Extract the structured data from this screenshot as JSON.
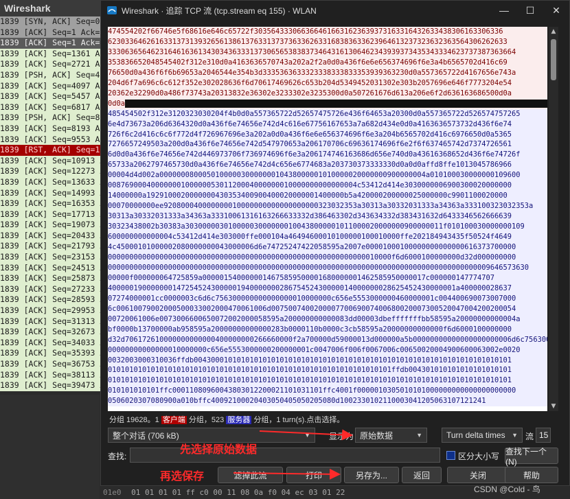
{
  "background": {
    "partial_title": "Wireshark",
    "rows": [
      {
        "text": "1839 [SYN, ACK] Seq=0",
        "style": "gray"
      },
      {
        "text": "1839 [ACK] Seq=1 Ack=3",
        "style": "gray"
      },
      {
        "text": "1839 [ACK] Seq=1 Ack=3",
        "style": "dark"
      },
      {
        "text": "1839 [ACK] Seq=1361 Ac",
        "style": "green"
      },
      {
        "text": "1839 [ACK] Seq=2721 Ac",
        "style": "green"
      },
      {
        "text": "1839 [PSH, ACK] Seq=40",
        "style": "green"
      },
      {
        "text": "1839 [ACK] Seq=4097 Ac",
        "style": "green"
      },
      {
        "text": "1839 [ACK] Seq=5457 Ac",
        "style": "green"
      },
      {
        "text": "1839 [ACK] Seq=6817 Ac",
        "style": "green"
      },
      {
        "text": "1839 [PSH, ACK] Seq=81",
        "style": "green"
      },
      {
        "text": "1839 [ACK] Seq=8193 Ac",
        "style": "green"
      },
      {
        "text": "1839 [ACK] Seq=9553 Ac",
        "style": "green"
      },
      {
        "text": "1839 [RST, ACK] Seq=1",
        "style": "red"
      },
      {
        "text": "1839 [ACK] Seq=10913 A",
        "style": "green"
      },
      {
        "text": "1839 [ACK] Seq=12273 A",
        "style": "green"
      },
      {
        "text": "1839 [ACK] Seq=13633 A",
        "style": "green"
      },
      {
        "text": "1839 [ACK] Seq=14993 A",
        "style": "green"
      },
      {
        "text": "1839 [ACK] Seq=16353 A",
        "style": "green"
      },
      {
        "text": "1839 [ACK] Seq=17713 A",
        "style": "green"
      },
      {
        "text": "1839 [ACK] Seq=19073 A",
        "style": "green"
      },
      {
        "text": "1839 [ACK] Seq=20433 A",
        "style": "green"
      },
      {
        "text": "1839 [ACK] Seq=21793 A",
        "style": "green"
      },
      {
        "text": "1839 [ACK] Seq=23153 A",
        "style": "green"
      },
      {
        "text": "1839 [ACK] Seq=24513 A",
        "style": "green"
      },
      {
        "text": "1839 [ACK] Seq=25873 A",
        "style": "green"
      },
      {
        "text": "1839 [ACK] Seq=27233 A",
        "style": "green"
      },
      {
        "text": "1839 [ACK] Seq=28593 A",
        "style": "green"
      },
      {
        "text": "1839 [ACK] Seq=29953 A",
        "style": "green"
      },
      {
        "text": "1839 [ACK] Seq=31313 A",
        "style": "green"
      },
      {
        "text": "1839 [ACK] Seq=32673 A",
        "style": "green"
      },
      {
        "text": "1839 [ACK] Seq=34033 A",
        "style": "green"
      },
      {
        "text": "1839 [ACK] Seq=35393 A",
        "style": "green"
      },
      {
        "text": "1839 [ACK] Seq=36753 A",
        "style": "green"
      },
      {
        "text": "1839 [ACK] Seq=38113 A",
        "style": "green"
      },
      {
        "text": "1839 [ACK] Seq=39473 A",
        "style": "green"
      }
    ],
    "hex_offset": "01e0",
    "hex_bytes": "01 01 01 01 ff c0 00 11  08 0a f0 04 ec 03 01 22"
  },
  "dialog": {
    "title": "Wireshark · 追踪 TCP 流 (tcp.stream eq 155) · WLAN",
    "window_controls": {
      "minimize": "—",
      "maximize": "☐",
      "close": "✕"
    },
    "client_lines": [
      "474554202f66746e5f68616e646c65722f3035643330663664616631623639373163316432633438306163306336",
      "623033646261633137313932656138613763313737363362633168383633623964613237323632363564306262633",
      "33306365646231646163613430343633313730656538383734643161306462343939373435343334623737387363664",
      "353836652048545402f312e310d0a4163636570743a202a2f2a0d0a436f6e6e656374696f6e3a4b6565702d416c69",
      "76650d0a436f6f6b69653a2046544e354b3d3335363633323338333833353939363230d0a557365722d4167656e743a",
      "204d6f7a696c6c612f352e302028636f6d70617469626c653b204d5349452031302e303b2057696e646f7773204e54",
      "20362e32290d0a486f73743a20313832e36302e3233302e3235300d0a507261676d613a206e6f2d636163686500d0a",
      "0d0a"
    ],
    "server_lines": [
      "485454502f312e3120323030204f4b0d0a557365722d52657475726e436f64653a20300d0a557365722d526574757265",
      "6e4d73673a206d6364320d0a436f6e74656e742d4c616e67756167653a7a682d434e0d0a4163636573732d436f6e74",
      "726f6c2d416c6c6f772d4f726967696e3a202a0d0a436f6e6e656374696f6e3a204b6565702d416c6976650d0a5365",
      "7276657249503a200d0a436f6e74656e742d547970653a206170706c69636174696f6e2f6f637465742d7374726561",
      "6d0d0a436f6e74656e742d446973706f736974696f6e3a206174746163686d656e740d0a43616368652d436f6e74726f",
      "65733a2062797465730d0a436f6e74656e742d4c656e6774683a203730373333330d0a0d0affd8ffe1013045786966",
      "00004d4d002a00000008000501000003000000010438000001010000020000000900000004a010100030000000109600",
      "0087690004000000010000005301120004000000010000000000000004c53412d414e3030000006900300020000000",
      "14000000a1929100020000000430353400900400020000001400000b5a420000200000025000000c9901100020000",
      "00070000000ee920800040000000010000000000000000000323032353a30313a30332031333a34363a333100323032353a",
      "30313a30332031333a34363a33310061316163266633332d386463302d343634332d383431632d6433346562666639",
      "30323438002b30383a303000003010000030000000100438000001011000020000000900000011f010100030000000109",
      "600000000000004c53412d414e303000ffe000104a46494600010100000100010000ffe202184943435f50524f4649",
      "4c45000101000002080000000043000006d6e74725247422058595a2007e00001000100000000000000616373700000",
      "000000000000000000000000000000000000000000000000000000000000010000f6d6000100000000d32d000000000",
      "00000000000000000000000000000000000000000000000000000000000000000000000000000000000000009646573630",
      "00000f000000064725859a0000015400000014675859500001680000001462585950000017c000000147774707",
      "400000190000000147254524300000194000000028675452430000014000000028625452430000001a400000028637",
      "07274000001cc0000003c6d6c756300000000000000010000000c656e5553000000460000001c004400690073007000",
      "6c00610079002000500033002000470061006d007500740020000770069007400680020007300520047004200200054",
      "00720061006e0073006600650072002000058595a200000000000083dd00003dbefffffffbb58595a20000000000004a",
      "bf0000b13700000ab958595a20000000000000283b0000110b0000c3cb58595a20000000000000f6d6000100000000",
      "d32d706172610000000000000400000000266660000f2a700000d59000013d000000a5b00000000000000000000006d6c756300",
      "00000000000000010000000c656e5553000000200000001c0047006f006f0067006c00650020004900600063002e0020",
      "0032003000310036ffdb00430001010101010101010101010101010101010101010101010101010101010101010101",
      "010101010101010101010101010101010101010101010101010101010101010101ffdb004301010101010101010101",
      "0101010101010101010101010101010101010101010101010101010101010101010101010101010101010101010101",
      "010101010101ffc00011080960043803012200021101031101ffc4001f0000010305010101000000000000000000000",
      "0506020307080900a010bffc40092100020403050405050205080d1002330102110003041205063107121241"
    ],
    "status": {
      "prefix": "分组 19628。",
      "client_count": "1",
      "client_tag": "客户端",
      "mid": " 分组，523",
      "server_tag": "服务器",
      "suffix": " 分组，1 turn(s).点击选择。"
    },
    "conversation_select": "整个对话 (706 kB)",
    "show_label": "显示为",
    "format_select": "原始数据",
    "delta_select": "Turn delta times",
    "stream_label": "流",
    "stream_value": "15",
    "find_label": "查找:",
    "find_value": "",
    "case_label": "区分大小写",
    "find_next": "查找下一个(N)",
    "buttons": {
      "filter_out": "滤掉此流",
      "print": "打印",
      "save_as": "另存为...",
      "back": "返回",
      "close": "关闭",
      "help": "帮助"
    }
  },
  "annotations": {
    "step1": "先选择原始数据",
    "step2": "再选保存",
    "color": "#ff2a2a"
  },
  "watermark": "CSDN @Cold - 鸟"
}
